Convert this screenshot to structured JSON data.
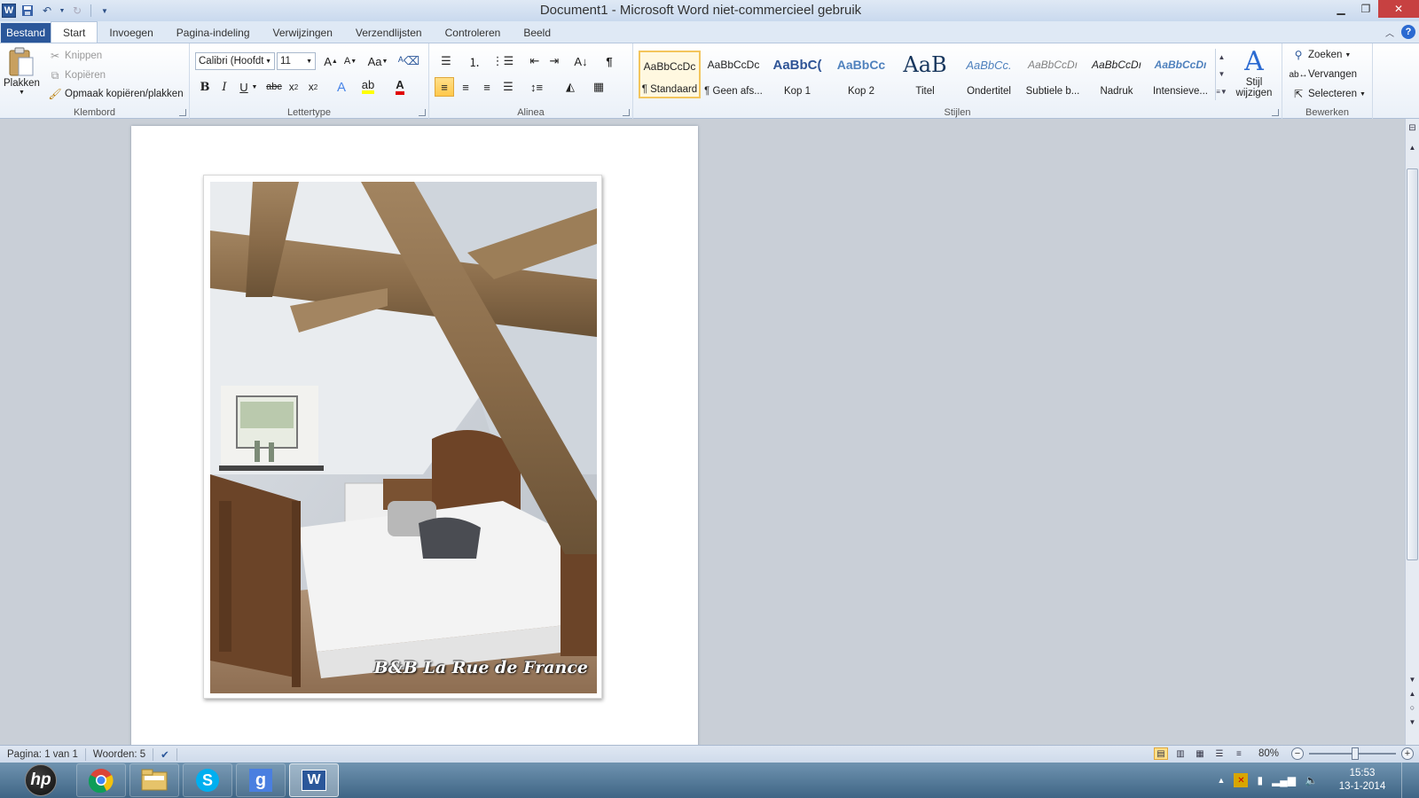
{
  "window": {
    "title": "Document1  -  Microsoft Word niet-commercieel gebruik",
    "app_icon_label": "W"
  },
  "tabs": {
    "file": "Bestand",
    "items": [
      "Start",
      "Invoegen",
      "Pagina-indeling",
      "Verwijzingen",
      "Verzendlijsten",
      "Controleren",
      "Beeld"
    ],
    "active": "Start"
  },
  "ribbon": {
    "clipboard": {
      "label": "Klembord",
      "paste": "Plakken",
      "cut": "Knippen",
      "copy": "Kopiëren",
      "format_painter": "Opmaak kopiëren/plakken"
    },
    "font": {
      "label": "Lettertype",
      "font_name": "Calibri (Hoofdt",
      "font_size": "11",
      "change_case": "Aa"
    },
    "paragraph": {
      "label": "Alinea"
    },
    "styles": {
      "label": "Stijlen",
      "items": [
        {
          "preview": "AaBbCcDc",
          "name": "¶ Standaard"
        },
        {
          "preview": "AaBbCcDc",
          "name": "¶ Geen afs..."
        },
        {
          "preview": "AaBbC(",
          "name": "Kop 1"
        },
        {
          "preview": "AaBbCc",
          "name": "Kop 2"
        },
        {
          "preview": "AaB",
          "name": "Titel"
        },
        {
          "preview": "AaBbCc.",
          "name": "Ondertitel"
        },
        {
          "preview": "AaBbCcDı",
          "name": "Subtiele b..."
        },
        {
          "preview": "AaBbCcDı",
          "name": "Nadruk"
        },
        {
          "preview": "AaBbCcDı",
          "name": "Intensieve..."
        }
      ],
      "change_styles_line1": "Stijl",
      "change_styles_line2": "wijzigen"
    },
    "editing": {
      "label": "Bewerken",
      "find": "Zoeken",
      "replace": "Vervangen",
      "select": "Selecteren"
    }
  },
  "document": {
    "photo_caption": "B&B La Rue de France"
  },
  "statusbar": {
    "page": "Pagina: 1 van 1",
    "words": "Woorden: 5",
    "zoom": "80%",
    "zoom_value_percent": 80
  },
  "taskbar": {
    "start_label": "hp",
    "apps": [
      "chrome-icon",
      "explorer-icon",
      "skype-icon",
      "google-icon",
      "word-icon"
    ],
    "skype_label": "S",
    "google_label": "g",
    "word_label": "W",
    "time": "15:53",
    "date": "13-1-2014"
  },
  "colors": {
    "file_tab": "#2b579a",
    "selected_style": "#f3c55c",
    "close_button": "#c74141",
    "heading_blue": "#2f5496"
  }
}
